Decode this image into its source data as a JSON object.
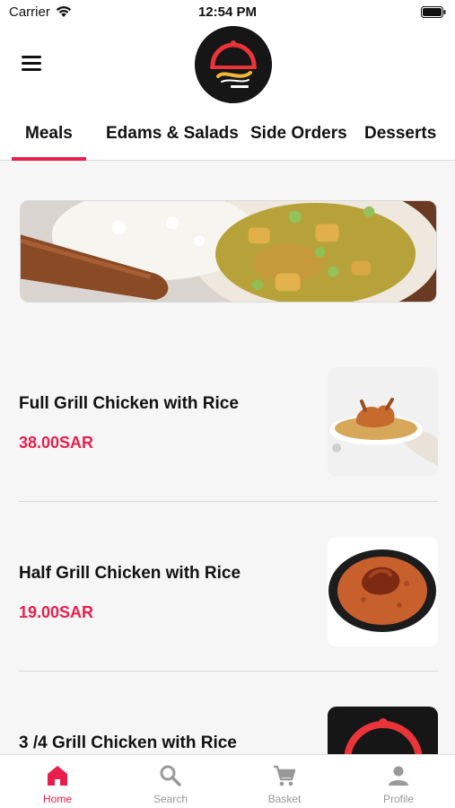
{
  "status_bar": {
    "carrier": "Carrier",
    "time": "12:54 PM",
    "icons": [
      "wifi-icon",
      "battery-icon"
    ]
  },
  "header": {
    "menu_icon": "hamburger-menu-icon",
    "logo_icon": "restaurant-logo"
  },
  "tabs": [
    {
      "label": "Meals",
      "active": true
    },
    {
      "label": "Edams & Salads",
      "active": false
    },
    {
      "label": "Side Orders",
      "active": false
    },
    {
      "label": "Desserts",
      "active": false
    }
  ],
  "meals": [
    {
      "name": "Full Grill Chicken with Rice",
      "price": "38.00SAR"
    },
    {
      "name": "Half Grill Chicken with Rice",
      "price": "19.00SAR"
    },
    {
      "name": "3 /4 Grill Chicken with Rice",
      "price": ""
    }
  ],
  "bottom_nav": [
    {
      "label": "Home",
      "icon": "home-icon",
      "active": true
    },
    {
      "label": "Search",
      "icon": "search-icon",
      "active": false
    },
    {
      "label": "Basket",
      "icon": "cart-icon",
      "active": false
    },
    {
      "label": "Profile",
      "icon": "profile-icon",
      "active": false
    }
  ],
  "colors": {
    "accent": "#e91e4d",
    "inactive": "#999999",
    "background": "#f6f6f6"
  }
}
